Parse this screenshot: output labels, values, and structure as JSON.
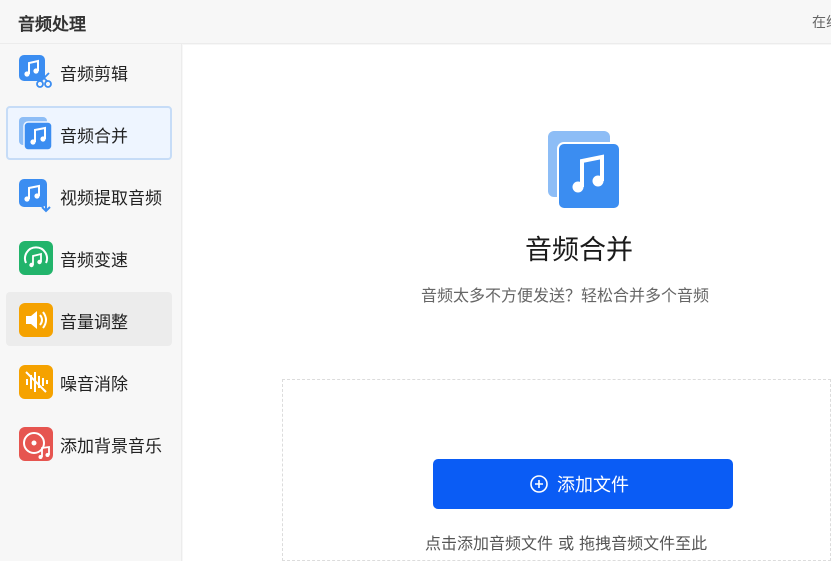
{
  "header": {
    "title": "音频处理",
    "right_text": "在线"
  },
  "sidebar": {
    "items": [
      {
        "label": "音频剪辑",
        "icon": "audio-cut-icon",
        "state": "normal"
      },
      {
        "label": "音频合并",
        "icon": "audio-merge-icon",
        "state": "active"
      },
      {
        "label": "视频提取音频",
        "icon": "video-extract-audio-icon",
        "state": "normal"
      },
      {
        "label": "音频变速",
        "icon": "audio-speed-icon",
        "state": "normal"
      },
      {
        "label": "音量调整",
        "icon": "volume-adjust-icon",
        "state": "hover"
      },
      {
        "label": "噪音消除",
        "icon": "noise-removal-icon",
        "state": "normal"
      },
      {
        "label": "添加背景音乐",
        "icon": "background-music-icon",
        "state": "normal"
      }
    ]
  },
  "main": {
    "title": "音频合并",
    "subtitle": "音频太多不方便发送？轻松合并多个音频",
    "add_button": "添加文件",
    "drop_hint": "点击添加音频文件 或 拖拽音频文件至此"
  },
  "colors": {
    "accent": "#0a5cf5",
    "active_bg": "#eef5ff",
    "icon_blue": "#3b8df1",
    "icon_green": "#22b46b",
    "icon_orange": "#f5a200",
    "icon_red": "#e65550"
  }
}
